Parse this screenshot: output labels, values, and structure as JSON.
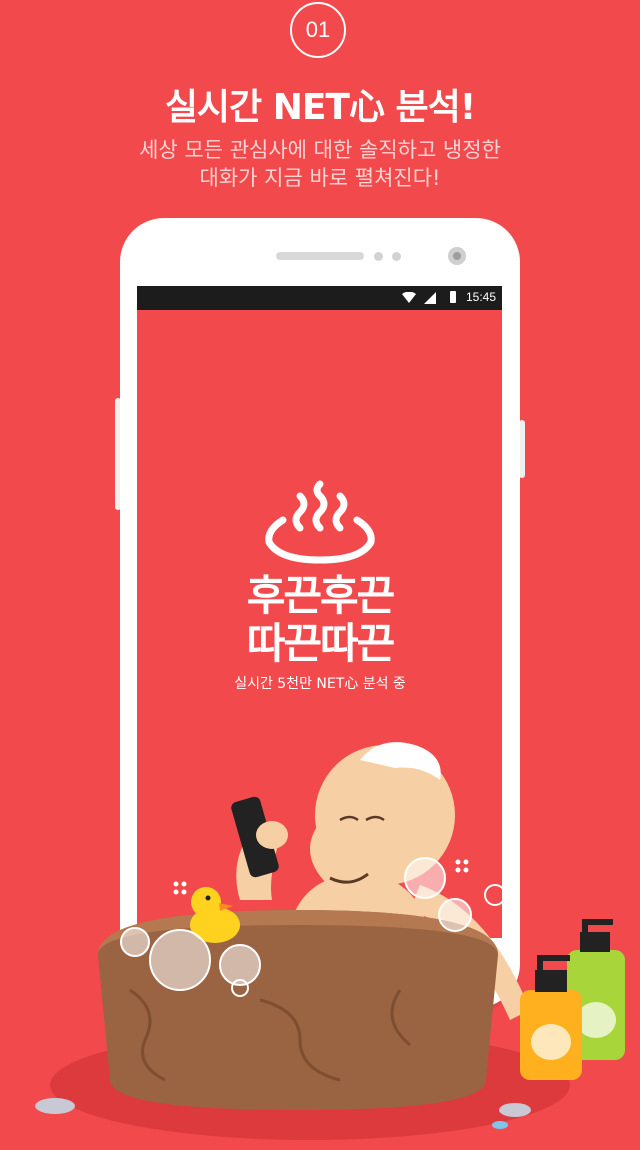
{
  "step_number": "01",
  "headline": "실시간 NET心 분석!",
  "subline_1": "세상 모든 관심사에 대한 솔직하고 냉정한",
  "subline_2": "대화가 지금 바로 펼쳐진다!",
  "status_bar": {
    "time": "15:45"
  },
  "app": {
    "name_line_1": "후끈후끈",
    "name_line_2": "따끈따끈",
    "tagline": "실시간 5천만 NET心 분석 중"
  },
  "colors": {
    "background": "#f24a4c",
    "text": "#ffffff",
    "subtext": "#ffd3d3"
  },
  "icons": [
    "hot-spring-icon",
    "wifi-icon",
    "signal-icon",
    "battery-icon"
  ]
}
